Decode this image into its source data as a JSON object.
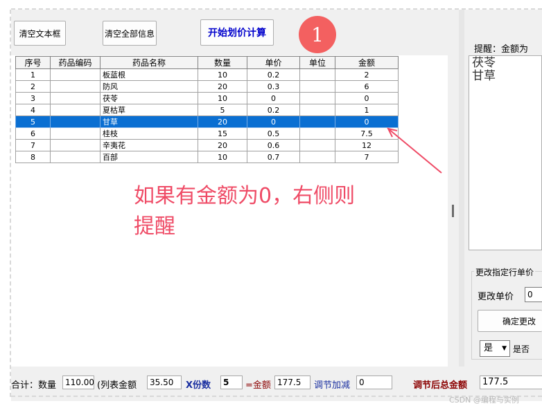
{
  "toolbar": {
    "clear_textbox_label": "清空文本框",
    "clear_all_label": "清空全部信息",
    "calc_label": "开始划价计算",
    "step_badge": "1"
  },
  "grid": {
    "columns": [
      "序号",
      "药品编码",
      "药品名称",
      "数量",
      "单价",
      "单位",
      "金额"
    ],
    "selected_row": 4,
    "rows": [
      [
        "1",
        "",
        "板蓝根",
        "10",
        "0.2",
        "",
        "2"
      ],
      [
        "2",
        "",
        "防风",
        "20",
        "0.3",
        "",
        "6"
      ],
      [
        "3",
        "",
        "茯苓",
        "10",
        "0",
        "",
        "0"
      ],
      [
        "4",
        "",
        "夏枯草",
        "5",
        "0.2",
        "",
        "1"
      ],
      [
        "5",
        "",
        "甘草",
        "20",
        "0",
        "",
        "0"
      ],
      [
        "6",
        "",
        "桂枝",
        "15",
        "0.5",
        "",
        "7.5"
      ],
      [
        "7",
        "",
        "辛夷花",
        "20",
        "0.6",
        "",
        "12"
      ],
      [
        "8",
        "",
        "百部",
        "10",
        "0.7",
        "",
        "7"
      ]
    ]
  },
  "annotation": {
    "line1": "如果有金额为0，右侧则",
    "line2": "提醒"
  },
  "right_panel": {
    "remind_label": "提醒：金额为",
    "remind_line1": "茯苓",
    "remind_line2": "甘草",
    "group_title": "更改指定行单价",
    "change_price_label": "更改单价",
    "change_price_value": "0",
    "confirm_label": "确定更改",
    "select_value": "是",
    "checkbox_label": "是否"
  },
  "status": {
    "total_label": "合计：数量",
    "qty_value": "110.00",
    "list_amount_label": "(列表金额",
    "list_amount_value": "35.50",
    "x_label": "X份数",
    "copies_value": "5",
    "eq_label": "=金额",
    "amount_value": "177.5",
    "adjust_label": "调节加减",
    "adjust_value": "0",
    "final_label": "调节后总金额",
    "final_value": "177.5"
  },
  "watermark": "CSDN @编程与实例",
  "colors": {
    "selection": "#0a6fd2",
    "annotation": "#ef4b66",
    "badge": "#f36060",
    "calc_text": "#0000cc"
  }
}
